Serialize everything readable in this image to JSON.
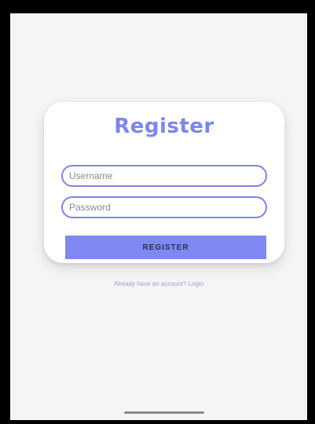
{
  "register_card": {
    "title": "Register",
    "username_placeholder": "Username",
    "password_placeholder": "Password",
    "register_button_label": "REGISTER"
  },
  "footer": {
    "login_link_text": "Already have an account? Login"
  },
  "colors": {
    "accent": "#7f88f2",
    "title": "#7a86f0",
    "input_border": "#7d84e8",
    "screen_background": "#f5f5f5",
    "card_background": "#ffffff"
  }
}
